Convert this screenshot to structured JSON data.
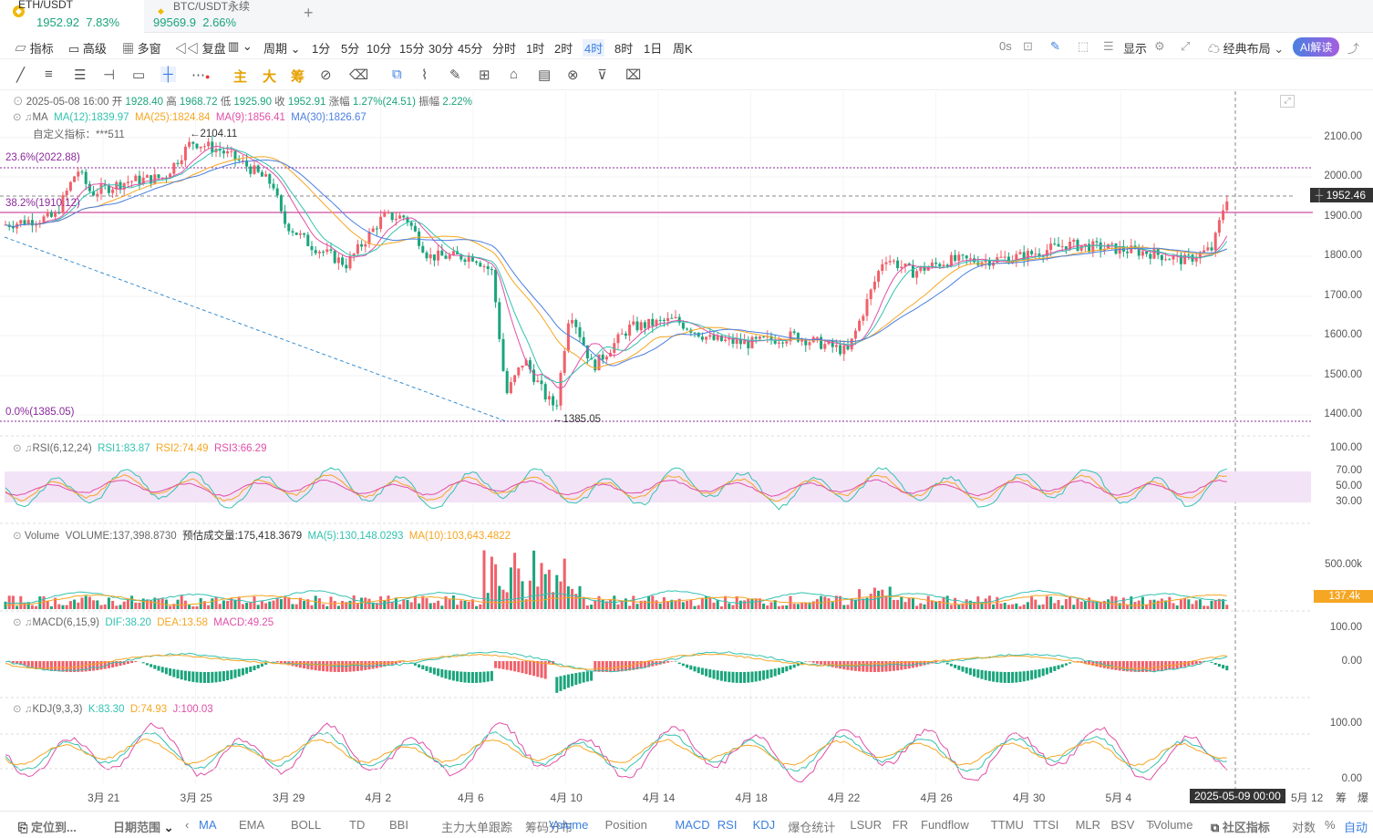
{
  "tabs": [
    {
      "symbol": "ETH/USDT",
      "price": "1952.92",
      "change": "7.83%"
    },
    {
      "symbol": "BTC/USDT永续",
      "price": "99569.9",
      "change": "2.66%"
    }
  ],
  "add_tab": "+",
  "toolbar": {
    "indicators": "指标",
    "advanced": "高级",
    "multi": "多窗",
    "replay": "复盘",
    "period": "周期",
    "intervals": [
      "1分",
      "5分",
      "10分",
      "15分",
      "30分",
      "45分",
      "分时",
      "1时",
      "2时",
      "4时",
      "8时",
      "1日",
      "周K"
    ],
    "active_interval": "4时",
    "countdown": "0s",
    "display": "显示",
    "layout": "经典布局",
    "ai": "AI解读"
  },
  "drawing_tools": [
    "主",
    "大",
    "筹"
  ],
  "ohlc": {
    "date": "2025-05-08 16:00",
    "open_label": "开",
    "open": "1928.40",
    "high_label": "高",
    "high": "1968.72",
    "low_label": "低",
    "low": "1925.90",
    "close_label": "收",
    "close": "1952.91",
    "chg_label": "涨幅",
    "chg": "1.27%(24.51)",
    "amp_label": "振幅",
    "amp": "2.22%"
  },
  "ma": {
    "label": "MA",
    "ma12": "MA(12):1839.97",
    "ma25": "MA(25):1824.84",
    "ma9": "MA(9):1856.41",
    "ma30": "MA(30):1826.67"
  },
  "custom": "自定义指标：***511",
  "fib": {
    "l236": "23.6%(2022.88)",
    "l382": "38.2%(1910.12)",
    "l0": "0.0%(1385.05)"
  },
  "high_mark": "2104.11",
  "low_mark": "1385.05",
  "price_axis": [
    "2100.00",
    "2000.00",
    "1900.00",
    "1800.00",
    "1700.00",
    "1600.00",
    "1500.00",
    "1400.00"
  ],
  "current_price": "1952.46",
  "rsi": {
    "label": "RSI(6,12,24)",
    "r1": "RSI1:83.87",
    "r2": "RSI2:74.49",
    "r3": "RSI3:66.29",
    "axis": [
      "100.00",
      "70.00",
      "50.00",
      "30.00"
    ]
  },
  "volume": {
    "label": "Volume",
    "vol": "VOLUME:137,398.8730",
    "est": "预估成交量:175,418.3679",
    "ma5": "MA(5):130,148.0293",
    "ma10": "MA(10):103,643.4822",
    "axis": "500.00k",
    "current": "137.4k"
  },
  "macd": {
    "label": "MACD(6,15,9)",
    "dif": "DIF:38.20",
    "dea": "DEA:13.58",
    "macd": "MACD:49.25",
    "axis": [
      "100.00",
      "0.00"
    ]
  },
  "kdj": {
    "label": "KDJ(9,3,3)",
    "k": "K:83.30",
    "d": "D:74.93",
    "j": "J:100.03",
    "axis": [
      "100.00",
      "0.00"
    ]
  },
  "x_axis": [
    "3月 21",
    "3月 25",
    "3月 29",
    "4月 2",
    "4月 6",
    "4月 10",
    "4月 14",
    "4月 18",
    "4月 22",
    "4月 26",
    "4月 30",
    "5月 4"
  ],
  "x_axis_right": "5月 12",
  "crosshair_time": "2025-05-09 00:00",
  "axis_tools": [
    "筹",
    "爆"
  ],
  "bottom": {
    "locate": "定位到...",
    "range": "日期范围",
    "items": [
      "MA",
      "EMA",
      "BOLL",
      "TD",
      "BBI",
      "主力大单跟踪",
      "筹码分布"
    ],
    "items2": [
      "Volume",
      "Position",
      "MACD",
      "RSI",
      "KDJ",
      "爆仓统计",
      "LSUR",
      "FR",
      "Fundflow",
      "TTMU",
      "TTSI",
      "MLR",
      "BSV",
      "TVolume"
    ],
    "community": "社区指标",
    "log": "对数",
    "pct": "%",
    "auto": "自动"
  },
  "colors": {
    "up": "#f0606a",
    "down": "#1aa47c",
    "ma12": "#33c2b0",
    "ma25": "#f5a623",
    "ma9": "#e04fa7",
    "ma30": "#4a7fe0"
  }
}
